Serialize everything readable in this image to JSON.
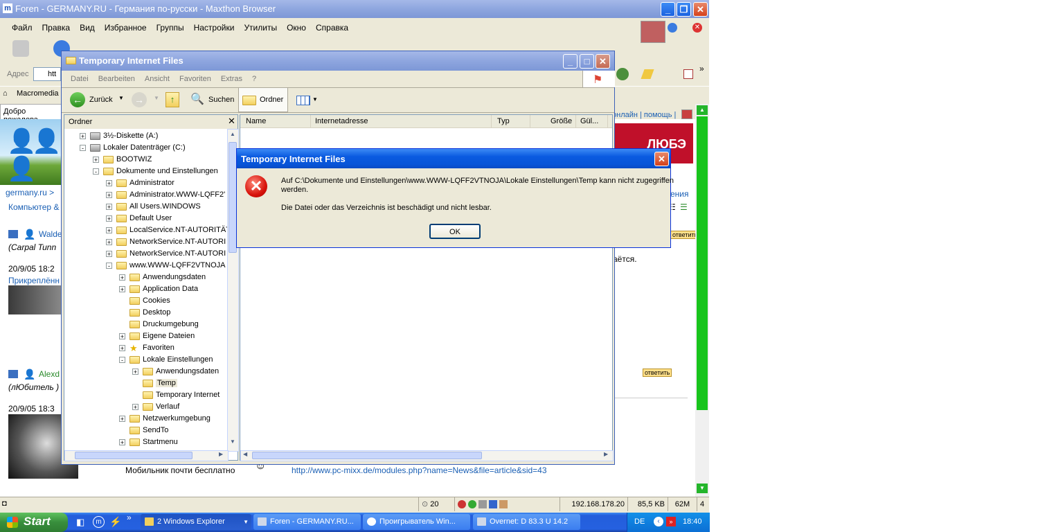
{
  "browser": {
    "title": "Foren - GERMANY.RU - Германия по-русски - Maxthon Browser",
    "menu": [
      "Файл",
      "Правка",
      "Вид",
      "Избранное",
      "Группы",
      "Настройки",
      "Утилиты",
      "Окно",
      "Справка"
    ],
    "address_label": "Адрес",
    "address_value": "htt",
    "links_bar_item": "Macromedia",
    "tab_label": "Добро пожалова",
    "page": {
      "breadcrumb": "germany.ru >",
      "sub_breadcrumb": "Компьютер &",
      "user1_name": "Walde",
      "user1_rank": "(Carpal Tunn",
      "user1_date": "20/9/05 18:2",
      "attachment": "Прикреплённ",
      "user2_name": "Alexd",
      "user2_rank": "(лЮбитель )",
      "user2_date": "20/9/05 18:3",
      "header_links": "онлайн | помощь |",
      "banner_text": "ЛЮБЭ",
      "right_text_1": "ения",
      "body_snippet": "аётся.",
      "reply_label": "ответить",
      "bottom_text": "Мобильник почти бесплатно",
      "bottom_link": "http://www.pc-mixx.de/modules.php?name=News&file=article&sid=43"
    },
    "status": {
      "count": "20",
      "ip": "192.168.178.20",
      "size": "85,5 KB",
      "memory": "62M",
      "num": "4"
    }
  },
  "explorer": {
    "title": "Temporary Internet Files",
    "menu": [
      "Datei",
      "Bearbeiten",
      "Ansicht",
      "Favoriten",
      "Extras",
      "?"
    ],
    "back_label": "Zurück",
    "search_label": "Suchen",
    "folders_label": "Ordner",
    "pane_title": "Ordner",
    "columns": [
      "Name",
      "Internetadresse",
      "Typ",
      "Größe",
      "Gül..."
    ],
    "tree": [
      {
        "label": "3½-Diskette (A:)",
        "indent": 1,
        "pm": "+",
        "icon": "floppy-icon"
      },
      {
        "label": "Lokaler Datenträger (C:)",
        "indent": 1,
        "pm": "-",
        "icon": "drive-icon"
      },
      {
        "label": "BOOTWIZ",
        "indent": 2,
        "pm": "+",
        "icon": "folder-icon"
      },
      {
        "label": "Dokumente und Einstellungen",
        "indent": 2,
        "pm": "-",
        "icon": "folder-icon"
      },
      {
        "label": "Administrator",
        "indent": 3,
        "pm": "+",
        "icon": "folder-icon"
      },
      {
        "label": "Administrator.WWW-LQFF2'",
        "indent": 3,
        "pm": "+",
        "icon": "folder-icon"
      },
      {
        "label": "All Users.WINDOWS",
        "indent": 3,
        "pm": "+",
        "icon": "folder-icon"
      },
      {
        "label": "Default User",
        "indent": 3,
        "pm": "+",
        "icon": "folder-icon"
      },
      {
        "label": "LocalService.NT-AUTORITÄT",
        "indent": 3,
        "pm": "+",
        "icon": "folder-icon"
      },
      {
        "label": "NetworkService.NT-AUTORI",
        "indent": 3,
        "pm": "+",
        "icon": "folder-icon"
      },
      {
        "label": "NetworkService.NT-AUTORI",
        "indent": 3,
        "pm": "+",
        "icon": "folder-icon"
      },
      {
        "label": "www.WWW-LQFF2VTNOJA",
        "indent": 3,
        "pm": "-",
        "icon": "folder-icon"
      },
      {
        "label": "Anwendungsdaten",
        "indent": 4,
        "pm": "+",
        "icon": "folder-icon"
      },
      {
        "label": "Application Data",
        "indent": 4,
        "pm": "+",
        "icon": "folder-icon"
      },
      {
        "label": "Cookies",
        "indent": 4,
        "pm": "",
        "icon": "folder-icon"
      },
      {
        "label": "Desktop",
        "indent": 4,
        "pm": "",
        "icon": "folder-icon"
      },
      {
        "label": "Druckumgebung",
        "indent": 4,
        "pm": "",
        "icon": "folder-icon"
      },
      {
        "label": "Eigene Dateien",
        "indent": 4,
        "pm": "+",
        "icon": "folder-icon"
      },
      {
        "label": "Favoriten",
        "indent": 4,
        "pm": "+",
        "icon": "star-icon"
      },
      {
        "label": "Lokale Einstellungen",
        "indent": 4,
        "pm": "-",
        "icon": "folder-icon"
      },
      {
        "label": "Anwendungsdaten",
        "indent": 5,
        "pm": "+",
        "icon": "folder-icon"
      },
      {
        "label": "Temp",
        "indent": 5,
        "pm": "",
        "icon": "folder-icon"
      },
      {
        "label": "Temporary Internet",
        "indent": 5,
        "pm": "",
        "icon": "folder-icon"
      },
      {
        "label": "Verlauf",
        "indent": 5,
        "pm": "+",
        "icon": "history-icon"
      },
      {
        "label": "Netzwerkumgebung",
        "indent": 4,
        "pm": "+",
        "icon": "folder-icon"
      },
      {
        "label": "SendTo",
        "indent": 4,
        "pm": "",
        "icon": "folder-icon"
      },
      {
        "label": "Startmenu",
        "indent": 4,
        "pm": "+",
        "icon": "folder-icon"
      }
    ]
  },
  "dialog": {
    "title": "Temporary Internet Files",
    "message_line1": "Auf C:\\Dokumente und Einstellungen\\www.WWW-LQFF2VTNOJA\\Lokale Einstellungen\\Temp kann nicht zugegriffen",
    "message_line2": "werden.",
    "message_line3": "Die Datei oder das Verzeichnis ist beschädigt und nicht lesbar.",
    "ok_label": "OK",
    "icon": "error-icon"
  },
  "taskbar": {
    "start_label": "Start",
    "tasks": [
      {
        "label": "2 Windows Explorer",
        "icon": "folder-icon"
      },
      {
        "label": "Foren - GERMANY.RU...",
        "icon": "maxthon-icon"
      },
      {
        "label": "Проигрыватель Win...",
        "icon": "media-player-icon"
      },
      {
        "label": "Overnet: D 83.3 U 14.2",
        "icon": "overnet-icon"
      }
    ],
    "lang": "DE",
    "clock": "18:40"
  }
}
